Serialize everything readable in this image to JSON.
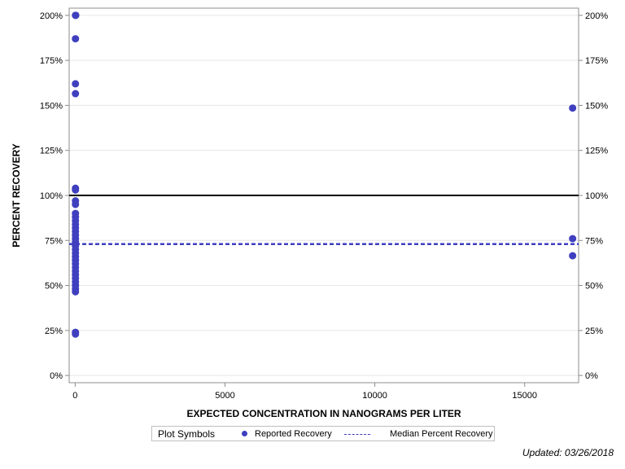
{
  "chart_data": {
    "type": "scatter",
    "xlabel": "EXPECTED CONCENTRATION IN NANOGRAMS PER LITER",
    "ylabel": "PERCENT RECOVERY",
    "xlim": [
      -200,
      16800
    ],
    "ylim": [
      -0.04,
      2.04
    ],
    "x_ticks": [
      0,
      5000,
      10000,
      15000
    ],
    "x_tick_labels": [
      "0",
      "5000",
      "10000",
      "15000"
    ],
    "y_ticks": [
      0,
      0.25,
      0.5,
      0.75,
      1.0,
      1.25,
      1.5,
      1.75,
      2.0
    ],
    "y_tick_labels": [
      "0%",
      "25%",
      "50%",
      "75%",
      "100%",
      "125%",
      "150%",
      "175%",
      "200%"
    ],
    "right_axis_labels": true,
    "grid": true,
    "legend_position": "bottom",
    "colors": {
      "points": "#3f3fbf",
      "median": "#3f3fbf",
      "reference": "#000000",
      "grid": "#e6e6e6",
      "axis": "#8c8c8c"
    },
    "reference_line": {
      "y": 1.0
    },
    "median_line": {
      "y": 0.73
    },
    "series": [
      {
        "name": "Reported Recovery",
        "points": [
          [
            10,
            2.0
          ],
          [
            20,
            2.0
          ],
          [
            10,
            1.87
          ],
          [
            10,
            1.62
          ],
          [
            10,
            1.565
          ],
          [
            10,
            1.04
          ],
          [
            10,
            1.03
          ],
          [
            10,
            0.97
          ],
          [
            10,
            0.95
          ],
          [
            10,
            0.9
          ],
          [
            10,
            0.88
          ],
          [
            10,
            0.86
          ],
          [
            10,
            0.84
          ],
          [
            10,
            0.82
          ],
          [
            10,
            0.8
          ],
          [
            10,
            0.78
          ],
          [
            10,
            0.76
          ],
          [
            10,
            0.74
          ],
          [
            10,
            0.72
          ],
          [
            10,
            0.7
          ],
          [
            10,
            0.68
          ],
          [
            10,
            0.66
          ],
          [
            10,
            0.64
          ],
          [
            10,
            0.62
          ],
          [
            10,
            0.6
          ],
          [
            10,
            0.58
          ],
          [
            10,
            0.56
          ],
          [
            10,
            0.54
          ],
          [
            10,
            0.52
          ],
          [
            10,
            0.5
          ],
          [
            10,
            0.48
          ],
          [
            10,
            0.465
          ],
          [
            10,
            0.24
          ],
          [
            10,
            0.23
          ],
          [
            16600,
            1.485
          ],
          [
            16600,
            0.76
          ],
          [
            16600,
            0.665
          ]
        ]
      }
    ]
  },
  "legend": {
    "title": "Plot Symbols",
    "items": [
      "Reported Recovery",
      "Median Percent Recovery"
    ]
  },
  "footer": {
    "updated": "Updated: 03/26/2018"
  }
}
